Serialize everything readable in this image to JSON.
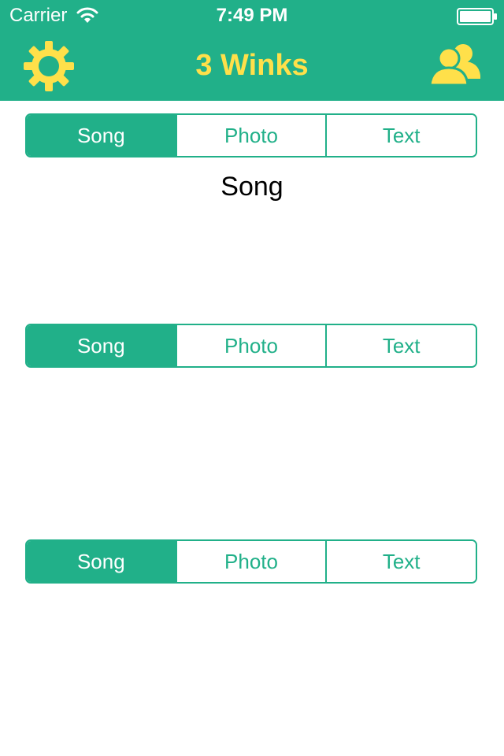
{
  "status_bar": {
    "carrier": "Carrier",
    "time": "7:49 PM"
  },
  "nav": {
    "title": "3 Winks",
    "left_icon": "gear-icon",
    "right_icon": "contacts-icon"
  },
  "colors": {
    "primary": "#21b089",
    "accent": "#ffe04a",
    "background": "#ffffff",
    "text": "#000000"
  },
  "sections": [
    {
      "segments": [
        "Song",
        "Photo",
        "Text"
      ],
      "selected": "Song",
      "content_label": "Song"
    },
    {
      "segments": [
        "Song",
        "Photo",
        "Text"
      ],
      "selected": "Song"
    },
    {
      "segments": [
        "Song",
        "Photo",
        "Text"
      ],
      "selected": "Song"
    }
  ]
}
